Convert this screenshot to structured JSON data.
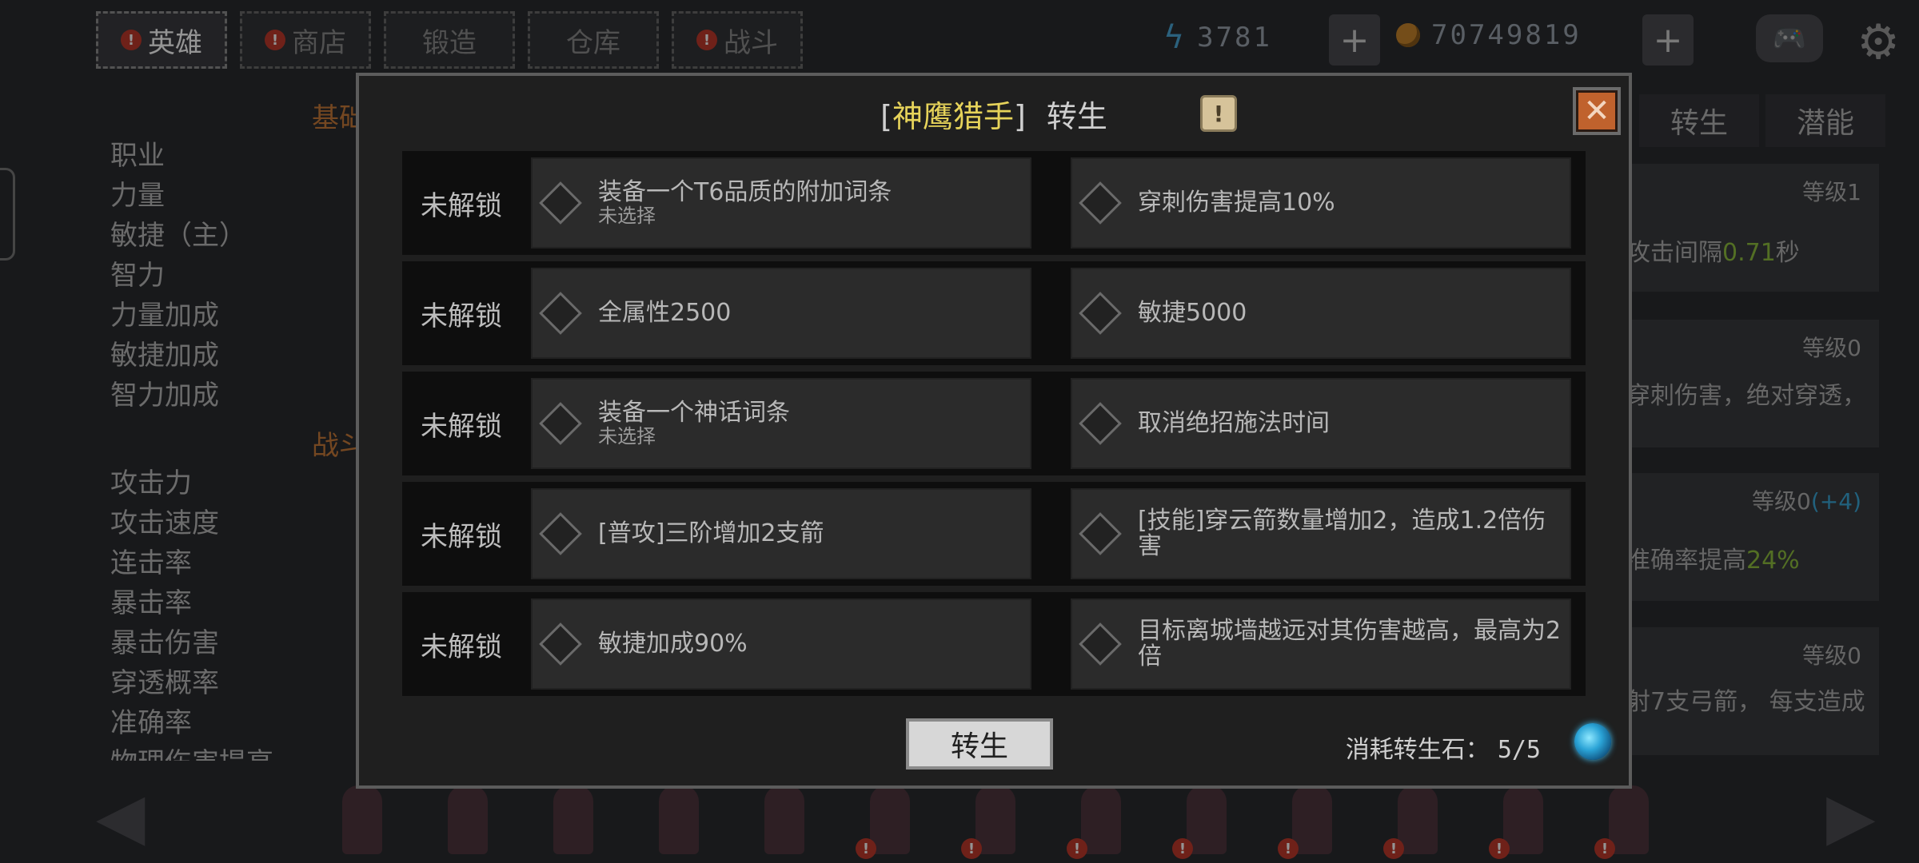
{
  "top_tabs": [
    {
      "label": "英雄",
      "alert": "!",
      "active": true
    },
    {
      "label": "商店",
      "alert": "!",
      "active": false
    },
    {
      "label": "锻造",
      "alert": "",
      "active": false
    },
    {
      "label": "仓库",
      "alert": "",
      "active": false
    },
    {
      "label": "战斗",
      "alert": "!",
      "active": false
    }
  ],
  "resources": {
    "energy": "3781",
    "gold": "70749819",
    "add_symbol": "+"
  },
  "stats": {
    "base_section_title": "基础",
    "base_items": [
      "职业",
      "力量",
      "敏捷（主）",
      "智力",
      "力量加成",
      "敏捷加成",
      "智力加成"
    ],
    "battle_section_title": "战斗",
    "battle_items": [
      "攻击力",
      "攻击速度",
      "连击率",
      "暴击率",
      "暴击伤害",
      "穿透概率",
      "准确率",
      "物理伤害提高"
    ]
  },
  "right_tabs": [
    "转生",
    "潜能"
  ],
  "right_cards": [
    {
      "level": "等级1",
      "text_a": "攻击间隔",
      "text_hl": "0.71",
      "text_b": "秒",
      "hl_color": "#8fbf3f"
    },
    {
      "level": "等级0",
      "text_a": "穿刺伤害，绝对穿透，",
      "text_hl": "",
      "text_b": ""
    },
    {
      "level": "等级0",
      "level_extra": "(+4)",
      "text_a": "准确率提高",
      "text_hl": "24%",
      "text_b": ""
    },
    {
      "level": "等级0",
      "text_a": "射7支弓箭， 每支造成",
      "text_hl": "",
      "text_b": ""
    }
  ],
  "modal": {
    "bracket_open": "[",
    "hero_name": "神鹰猎手",
    "bracket_close": "]",
    "title_suffix": "转生",
    "info_symbol": "!",
    "close_symbol": "✕",
    "rows": [
      {
        "status": "未解锁",
        "left": {
          "main": "装备一个T6品质的附加词条",
          "sub": "未选择"
        },
        "right": {
          "main": "穿刺伤害提高10%",
          "sub": ""
        }
      },
      {
        "status": "未解锁",
        "left": {
          "main": "全属性2500",
          "sub": ""
        },
        "right": {
          "main": "敏捷5000",
          "sub": ""
        }
      },
      {
        "status": "未解锁",
        "left": {
          "main": "装备一个神话词条",
          "sub": "未选择"
        },
        "right": {
          "main": "取消绝招施法时间",
          "sub": ""
        }
      },
      {
        "status": "未解锁",
        "left": {
          "main": "[普攻]三阶增加2支箭",
          "sub": ""
        },
        "right": {
          "main": "[技能]穿云箭数量增加2，造成1.2倍伤害",
          "sub": ""
        }
      },
      {
        "status": "未解锁",
        "left": {
          "main": "敏捷加成90%",
          "sub": ""
        },
        "right": {
          "main": "目标离城墙越远对其伤害越高，最高为2倍",
          "sub": ""
        }
      }
    ],
    "rebirth_button": "转生",
    "cost_label": "消耗转生石：",
    "cost_value": "5/5"
  },
  "hero_strip": {
    "alert": "!"
  },
  "colors": {
    "hero_name": "#e6d35a",
    "stat_section": "#c87a3a",
    "close_button": "#c0622d",
    "alert": "#c0392b",
    "stone": "#2aa3d6"
  }
}
